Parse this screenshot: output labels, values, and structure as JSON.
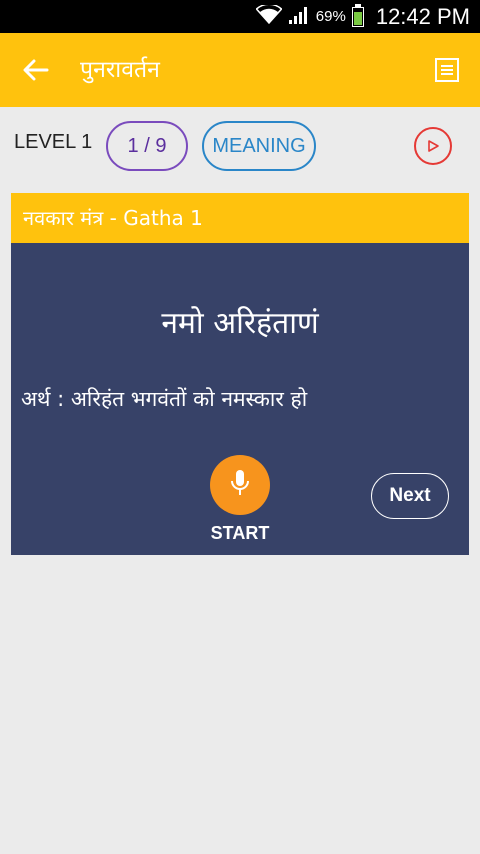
{
  "status_bar": {
    "battery_percent": "69%",
    "time": "12:42 PM",
    "battery_color": "#7ac943"
  },
  "app_bar": {
    "title": "पुनरावर्तन",
    "back_icon": "arrow-left-icon",
    "menu_icon": "list-icon",
    "color": "#ffc20d"
  },
  "level_bar": {
    "level_label": "LEVEL 1",
    "count": "1 / 9",
    "meaning_button": "MEANING",
    "play_icon": "play-icon"
  },
  "card": {
    "header": "नवकार मंत्र - Gatha 1",
    "verse": "नमो अरिहंताणं",
    "meaning": "अर्थ : अरिहंत भगवंतों को नमस्कार हो",
    "mic_icon": "microphone-icon",
    "start_label": "START",
    "next_label": "Next",
    "background": "#374268"
  }
}
